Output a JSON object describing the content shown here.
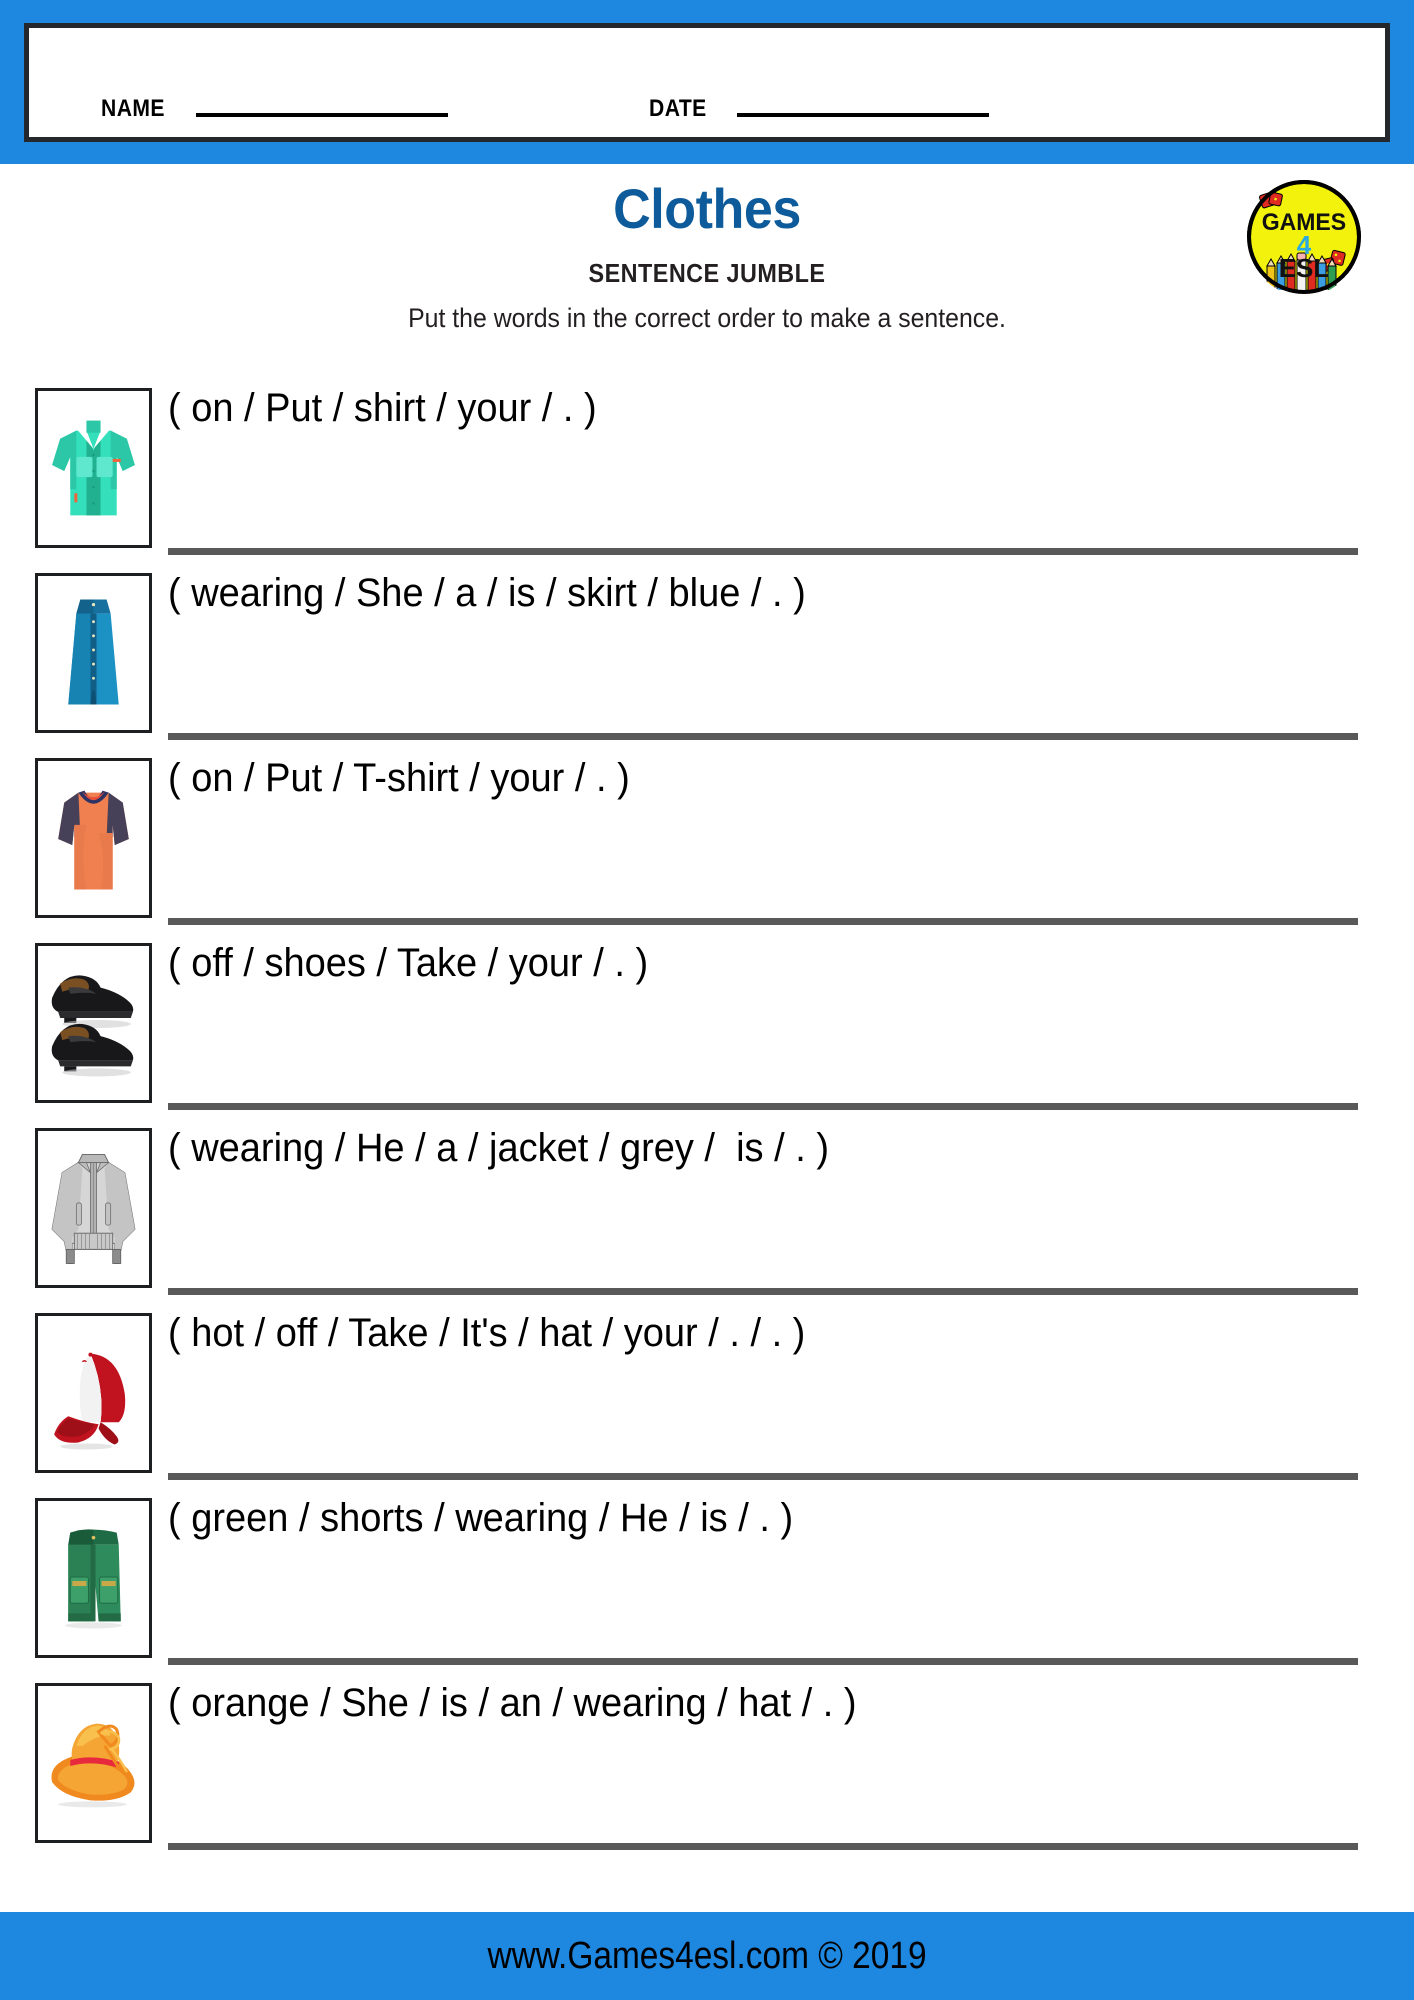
{
  "header": {
    "name_label": "NAME",
    "date_label": "DATE"
  },
  "title": "Clothes",
  "subtitle": "SENTENCE JUMBLE",
  "instructions": "Put the words in the correct order to make a sentence.",
  "logo": {
    "line1": "GAMES",
    "line2": "4",
    "line3": "ESL",
    "circle_color": "#f2f20d",
    "border_color": "#000000",
    "four_color": "#29abe2"
  },
  "colors": {
    "band_blue": "#1e88e0",
    "title_blue": "#0d5b9a",
    "rule_gray": "#595959",
    "box_black": "#1d1f21"
  },
  "questions": [
    {
      "icon": "shirt-icon",
      "prompt": "( on / Put / shirt / your / . )"
    },
    {
      "icon": "skirt-icon",
      "prompt": "( wearing / She / a / is / skirt / blue / . )"
    },
    {
      "icon": "tshirt-icon",
      "prompt": "( on / Put / T-shirt / your / . )"
    },
    {
      "icon": "shoes-icon",
      "prompt": "( off / shoes / Take / your / . )"
    },
    {
      "icon": "jacket-icon",
      "prompt": "( wearing / He / a / jacket / grey /  is / . )"
    },
    {
      "icon": "cap-icon",
      "prompt": "( hot / off / Take / It's / hat / your / . / . )"
    },
    {
      "icon": "shorts-icon",
      "prompt": "( green / shorts / wearing / He / is / . )"
    },
    {
      "icon": "sunhat-icon",
      "prompt": "( orange / She / is / an / wearing / hat / . )"
    }
  ],
  "footer": "www.Games4esl.com © 2019"
}
